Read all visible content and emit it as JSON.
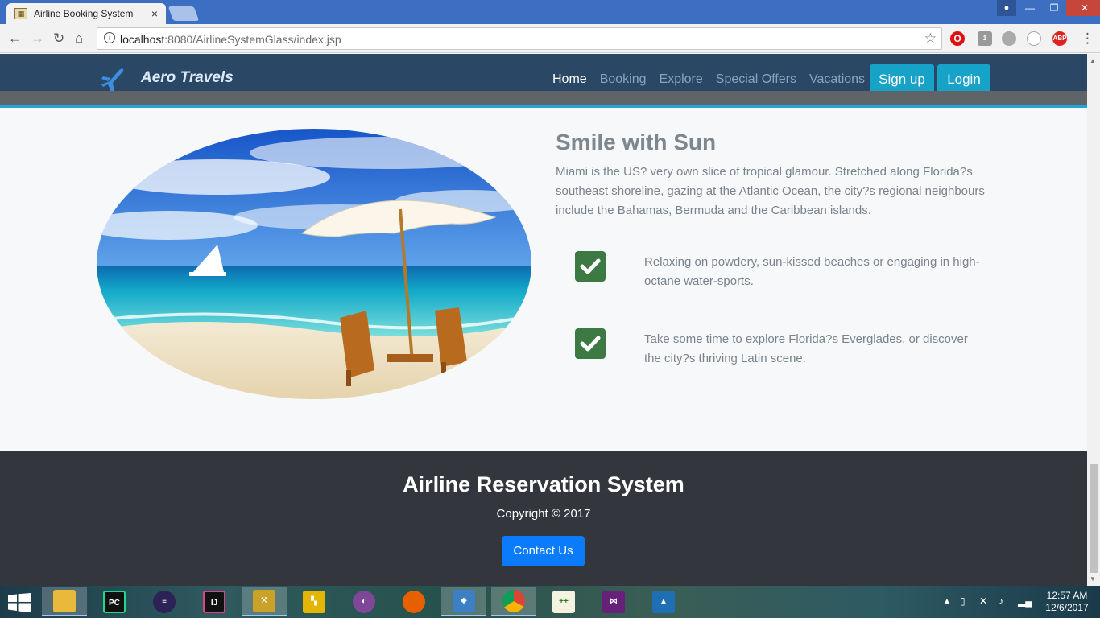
{
  "browser": {
    "tab_title": "Airline Booking System",
    "tab_close": "×",
    "url_host": "localhost",
    "url_path": ":8080/AirlineSystemGlass/index.jsp",
    "abp_label": "ABP",
    "ext_badge": "1"
  },
  "navbar": {
    "brand": "Aero Travels",
    "links": [
      "Home",
      "Booking",
      "Explore",
      "Special Offers",
      "Vacations"
    ],
    "signup_label": "Sign up",
    "login_label": "Login"
  },
  "section": {
    "heading": "Smile with Sun",
    "intro": "Miami is the US? very own slice of tropical glamour. Stretched along Florida?s southeast shoreline, gazing at the Atlantic Ocean, the city?s regional neighbours include the Bahamas, Bermuda and the Caribbean islands.",
    "features": [
      "Relaxing on powdery, sun-kissed beaches or engaging in high-octane water-sports.",
      "Take some time to explore Florida?s Everglades, or discover the city?s thriving Latin scene."
    ]
  },
  "footer": {
    "title": "Airline Reservation System",
    "copyright": "Copyright © 2017",
    "contact_label": "Contact Us"
  },
  "taskbar": {
    "time": "12:57 AM",
    "date": "12/6/2017",
    "apps": [
      "file-explorer",
      "pycharm",
      "eclipse",
      "intellij",
      "tools",
      "app-5",
      "tor",
      "firefox",
      "virtualbox",
      "chrome",
      "notepad-plus",
      "visual-studio",
      "matlab"
    ]
  },
  "colors": {
    "navbar_bg": "#2a4766",
    "accent_cyan": "#17a2c8",
    "check_green": "#3d7a43",
    "footer_bg": "#33373d",
    "contact_blue": "#0a7bfb"
  }
}
